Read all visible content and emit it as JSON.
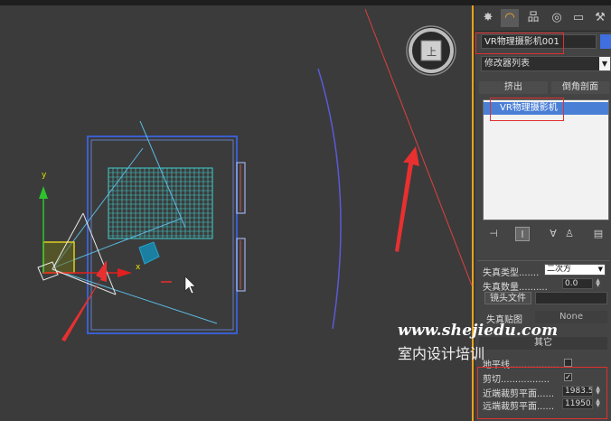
{
  "viewport": {
    "axis_y": "y",
    "axis_x": "x",
    "viewcube_face": "上",
    "axis_color_y": "#2cc52c",
    "axis_color_x": "#e02020",
    "camera_color": "#d8d8d8",
    "grid_color": "#40d0d0",
    "room_border_color": "#3a5fd0"
  },
  "panel": {
    "tabs": [
      {
        "icon": "sun-icon",
        "glyph": "✸"
      },
      {
        "icon": "curve-icon",
        "glyph": "◠"
      },
      {
        "icon": "hierarchy-icon",
        "glyph": "品"
      },
      {
        "icon": "motion-icon",
        "glyph": "◎"
      },
      {
        "icon": "display-icon",
        "glyph": "▭"
      },
      {
        "icon": "utilities-icon",
        "glyph": "⚒"
      }
    ],
    "object_name": "VR物理摄影机001",
    "object_color": "#3f6fe0",
    "modifier_list": "修改器列表",
    "buttons": {
      "extrude": "挤出",
      "bevel_profile": "倒角剖面"
    },
    "stack_item": "VR物理摄影机",
    "stack_tools": [
      {
        "icon": "pin-stack-icon",
        "glyph": "⊣"
      },
      {
        "icon": "show-end-result-icon",
        "glyph": "I"
      },
      {
        "icon": "make-unique-icon",
        "glyph": "∀"
      },
      {
        "icon": "remove-modifier-icon",
        "glyph": "♙"
      },
      {
        "icon": "configure-modifier-sets-icon",
        "glyph": "▤"
      }
    ],
    "params": {
      "distortion_type_label": "失真类型.......",
      "distortion_type_value": "二次方",
      "distortion_amount_label": "失真数量..........",
      "distortion_amount_value": "0.0",
      "lens_file_button": "镜头文件",
      "distortion_map_label": "失真贴图",
      "distortion_map_value": "None",
      "misc_header": "其它",
      "horizon_label": "地平线.................",
      "horizon_checked": false,
      "clipping_label": "剪切.................",
      "clipping_checked": true,
      "near_clip_label": "近端裁剪平面......",
      "near_clip_value": "1983.5",
      "far_clip_label": "远端裁剪平面......",
      "far_clip_value": "11950."
    }
  },
  "watermark": {
    "url": "www.shejiedu.com",
    "text": "室内设计培训"
  }
}
